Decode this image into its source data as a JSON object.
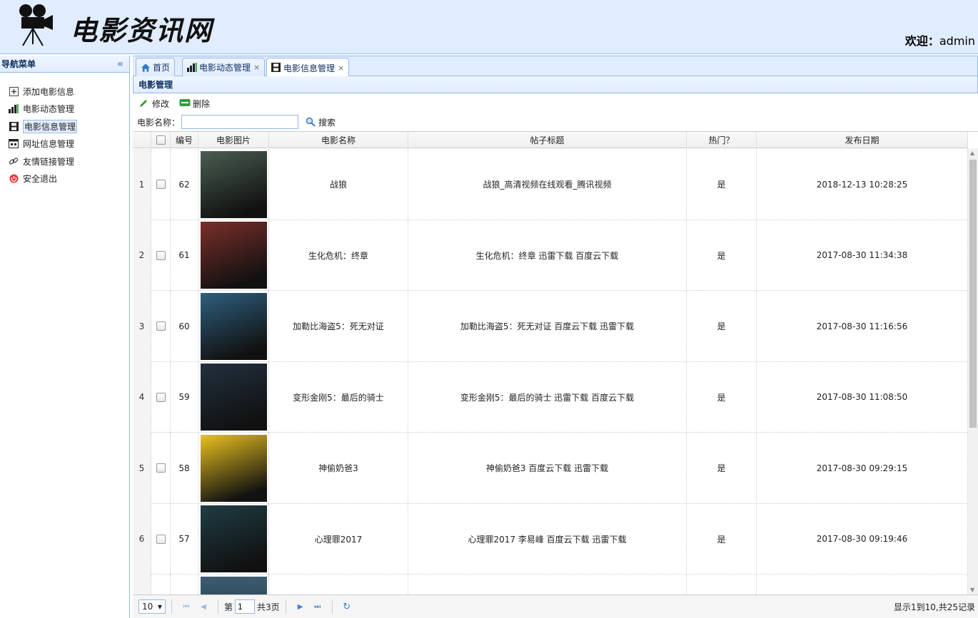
{
  "header": {
    "logo_text": "电影资讯网",
    "welcome_label": "欢迎：",
    "username": "admin"
  },
  "sidebar": {
    "title": "导航菜单",
    "items": [
      {
        "label": "添加电影信息",
        "icon": "add-icon"
      },
      {
        "label": "电影动态管理",
        "icon": "bar-chart-icon"
      },
      {
        "label": "电影信息管理",
        "icon": "film-icon"
      },
      {
        "label": "网址信息管理",
        "icon": "web-icon"
      },
      {
        "label": "友情链接管理",
        "icon": "link-icon"
      },
      {
        "label": "安全退出",
        "icon": "exit-icon"
      }
    ]
  },
  "tabs": [
    {
      "label": "首页",
      "icon": "home-icon"
    },
    {
      "label": "电影动态管理",
      "icon": "bar-chart-icon"
    },
    {
      "label": "电影信息管理",
      "icon": "film-icon"
    }
  ],
  "panel": {
    "title": "电影管理"
  },
  "toolbar": {
    "edit_label": "修改",
    "delete_label": "删除"
  },
  "search": {
    "label": "电影名称：",
    "value": "",
    "button_label": "搜索"
  },
  "grid": {
    "columns": [
      "编号",
      "电影图片",
      "电影名称",
      "帖子标题",
      "热门？",
      "发布日期"
    ],
    "rows": [
      {
        "n": "1",
        "id": "62",
        "name": "战狼",
        "title": "战狼_高清视频在线观看_腾讯视频",
        "hot": "是",
        "date": "2018-12-13 10:28:25",
        "poster": "#4a5e52"
      },
      {
        "n": "2",
        "id": "61",
        "name": "生化危机：终章",
        "title": "生化危机：终章 迅雷下载 百度云下载",
        "hot": "是",
        "date": "2017-08-30 11:34:38",
        "poster": "#7a2f2a"
      },
      {
        "n": "3",
        "id": "60",
        "name": "加勒比海盗5：死无对证",
        "title": "加勒比海盗5：死无对证 百度云下载 迅雷下载",
        "hot": "是",
        "date": "2017-08-30 11:16:56",
        "poster": "#2e5f7d"
      },
      {
        "n": "4",
        "id": "59",
        "name": "变形金刚5：最后的骑士",
        "title": "变形金刚5：最后的骑士 迅雷下载 百度云下载",
        "hot": "是",
        "date": "2017-08-30 11:08:50",
        "poster": "#22303e"
      },
      {
        "n": "5",
        "id": "58",
        "name": "神偷奶爸3",
        "title": "神偷奶爸3 百度云下载 迅雷下载",
        "hot": "是",
        "date": "2017-08-30 09:29:15",
        "poster": "#e9c21e"
      },
      {
        "n": "6",
        "id": "57",
        "name": "心理罪2017",
        "title": "心理罪2017 李易峰 百度云下载 迅雷下载",
        "hot": "是",
        "date": "2017-08-30 09:19:46",
        "poster": "#1f3d44"
      }
    ]
  },
  "pager": {
    "page_size": "10",
    "page_prefix": "第",
    "page_value": "1",
    "page_total": "共3页",
    "info": "显示1到10,共25记录"
  },
  "colors": {
    "accent": "#95b8e7",
    "header_bg": "#e0ecff",
    "pager_blue": "#3c82d8"
  }
}
